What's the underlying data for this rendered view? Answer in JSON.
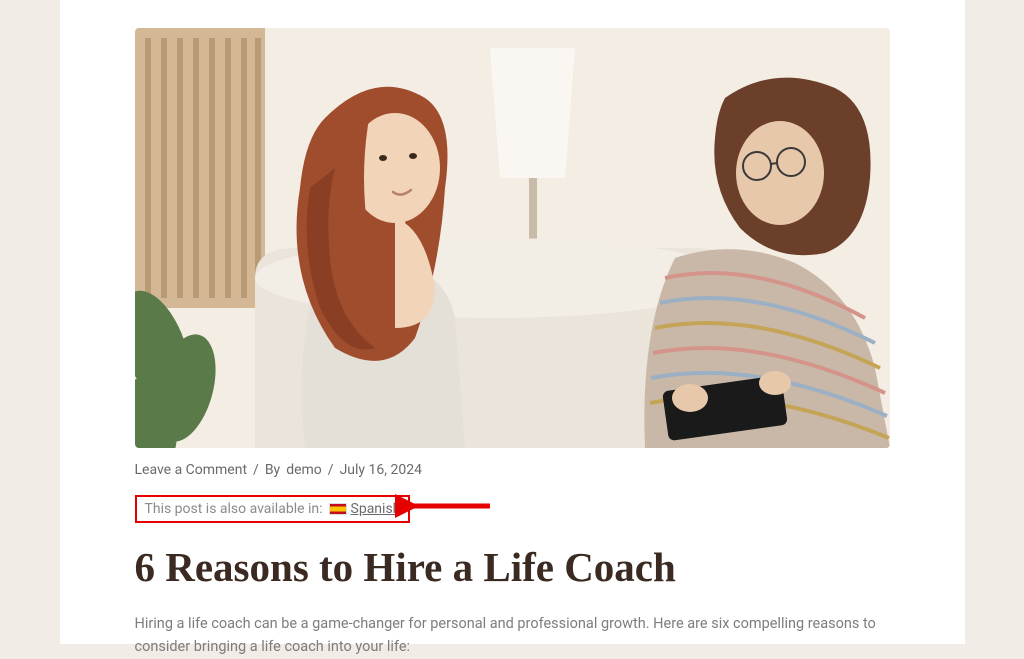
{
  "meta": {
    "comment_link": "Leave a Comment",
    "by_prefix": "By",
    "author": "demo",
    "date": "July 16, 2024"
  },
  "language_notice": {
    "prefix": "This post is also available in:",
    "language_name": "Spanish"
  },
  "article": {
    "title": "6 Reasons to Hire a Life Coach",
    "intro": "Hiring a life coach can be a game-changer for personal and professional growth. Here are six compelling reasons to consider bringing a life coach into your life:"
  }
}
